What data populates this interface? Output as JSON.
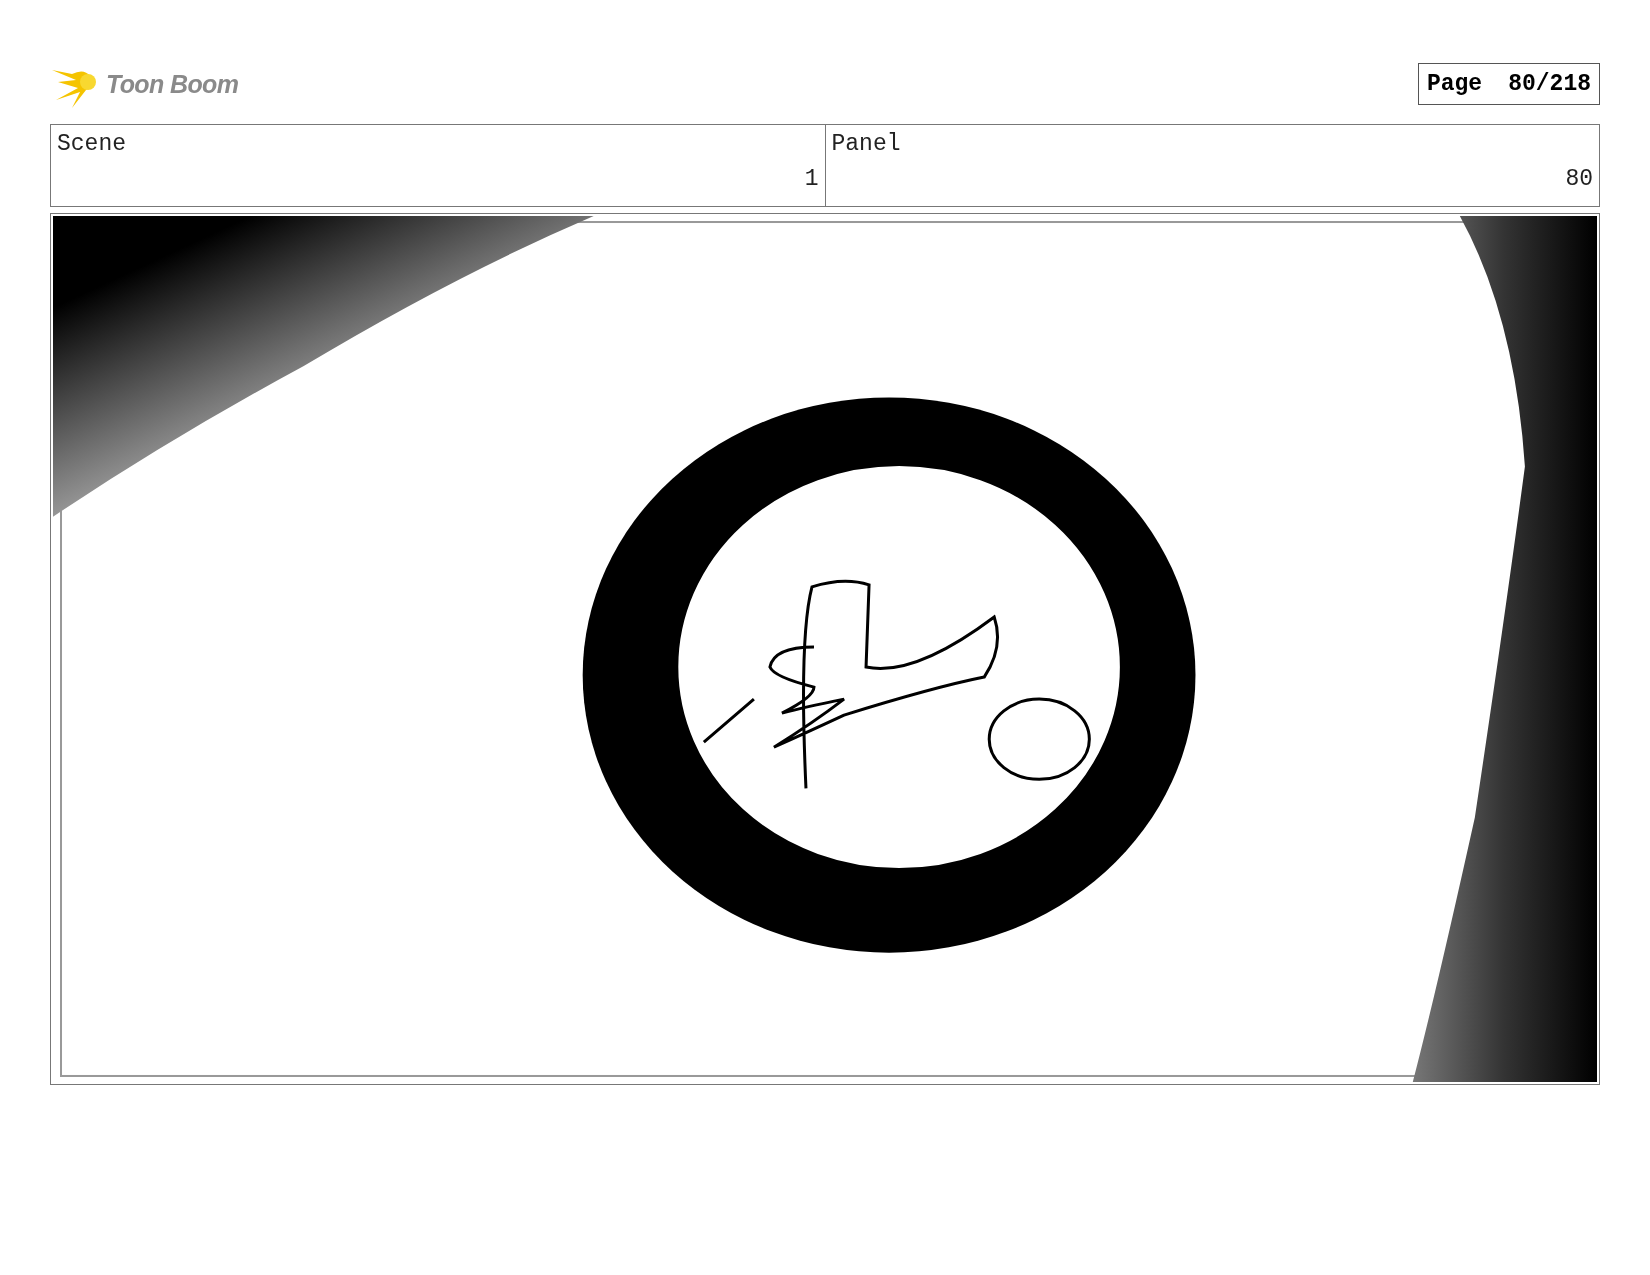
{
  "logo": {
    "text": "Toon Boom"
  },
  "page": {
    "label": "Page",
    "number": "80/218"
  },
  "scene": {
    "label": "Scene",
    "number": "1"
  },
  "panel": {
    "label": "Panel",
    "number": "80"
  }
}
